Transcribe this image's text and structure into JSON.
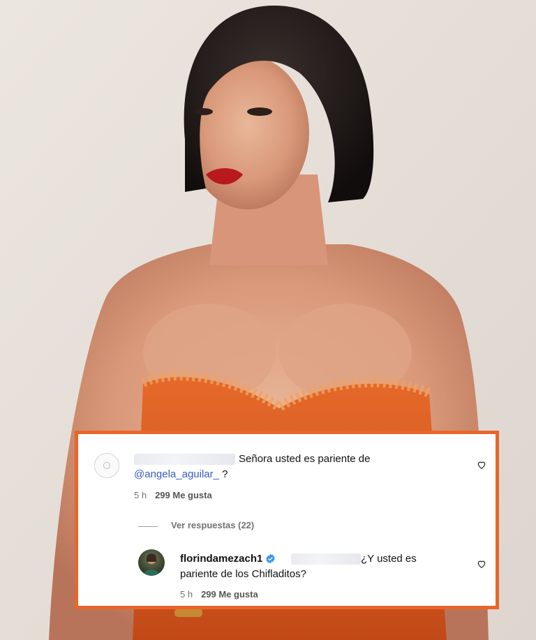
{
  "comments": [
    {
      "name_blurred": true,
      "text": "Señora usted es pariente de",
      "mention": "@angela_aguilar_",
      "text_after_mention": "?",
      "time": "5 h",
      "likes": "299 Me gusta",
      "avatar_icon": "default-avatar-icon",
      "like_icon": "heart-icon"
    }
  ],
  "replies_toggle": "Ver respuestas (22)",
  "reply": {
    "username": "florindamezach1",
    "verified_icon": "verified-badge-icon",
    "mention_blurred": true,
    "text_line1": "¿Y usted es",
    "text_line2": "pariente de los Chifladitos?",
    "time": "5 h",
    "likes": "299 Me gusta",
    "like_icon": "heart-icon"
  },
  "colors": {
    "card_border": "#e8662a",
    "mention": "#3a5bc7",
    "verified": "#3897f0",
    "dress": "#d4561e",
    "background": "#e9e2dc"
  }
}
